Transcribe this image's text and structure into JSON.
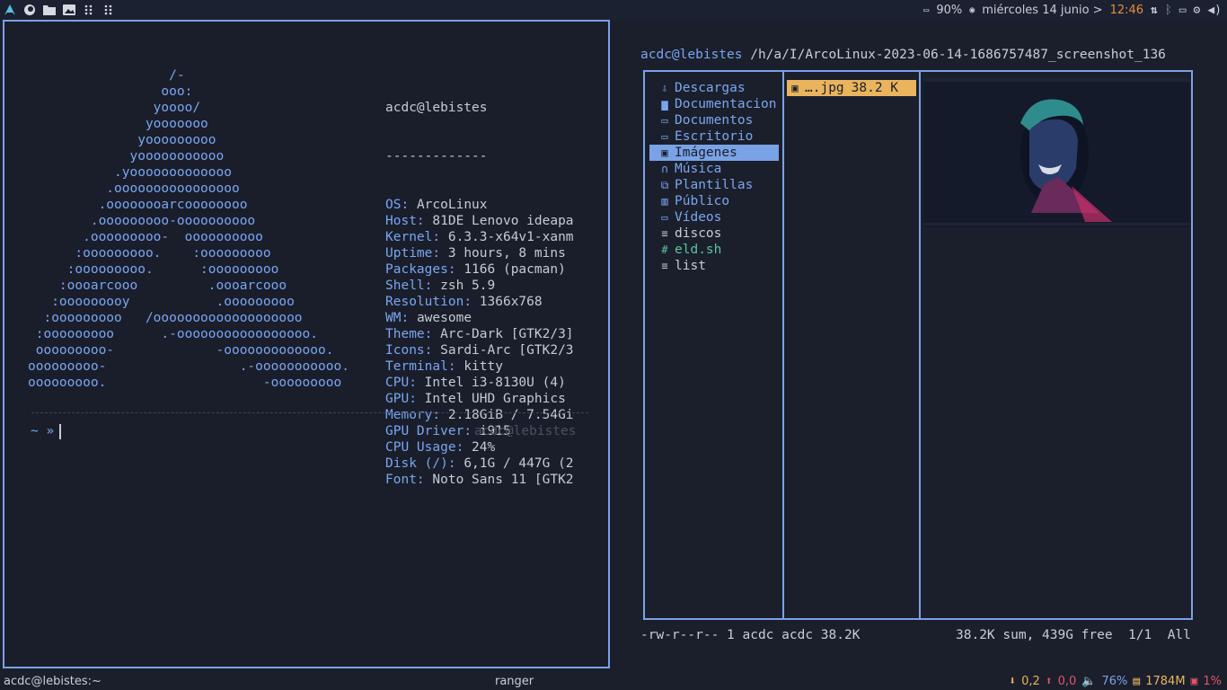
{
  "colors": {
    "accent": "#7aa2e6",
    "background": "#1b1f2c",
    "orange": "#e98a3f",
    "green": "#58c69a",
    "yellow": "#e9b45c",
    "red": "#e0566a"
  },
  "topbar": {
    "icons": [
      "arch-logo-icon",
      "firefox-icon",
      "folder-icon",
      "image-viewer-icon",
      "grid-icon",
      "grid-icon"
    ],
    "battery": "90%",
    "date": "miércoles 14 junio >",
    "time": "12:46"
  },
  "terminal": {
    "ascii_lines": [
      "                  /-",
      "                 ooo:",
      "                yoooo/",
      "               yooooooo",
      "              yooooooooo",
      "             yooooooooooo",
      "           .yooooooooooooo",
      "          .oooooooooooooooo",
      "         .oooooooarcoooooooo",
      "        .ooooooooo-oooooooooo",
      "       .ooooooooo-  oooooooooo",
      "      :ooooooooo.    :ooooooooo",
      "     :ooooooooo.      :ooooooooo",
      "    :oooarcooo         .oooarcooo",
      "   :ooooooooy           .ooooooooo",
      "  :ooooooooo   /ooooooooooooooooooo",
      " :ooooooooo      .-ooooooooooooooooo.",
      " ooooooooo-             -ooooooooooooo.",
      "ooooooooo-                 .-ooooooooooo.",
      "ooooooooo.                    -ooooooooo"
    ],
    "userhost": "acdc@lebistes",
    "underline": "-------------",
    "info": [
      {
        "key": "OS",
        "value": "ArcoLinux"
      },
      {
        "key": "Host",
        "value": "81DE Lenovo ideapa"
      },
      {
        "key": "Kernel",
        "value": "6.3.3-x64v1-xanm"
      },
      {
        "key": "Uptime",
        "value": "3 hours, 8 mins"
      },
      {
        "key": "Packages",
        "value": "1166 (pacman)"
      },
      {
        "key": "Shell",
        "value": "zsh 5.9"
      },
      {
        "key": "Resolution",
        "value": "1366x768"
      },
      {
        "key": "WM",
        "value": "awesome"
      },
      {
        "key": "Theme",
        "value": "Arc-Dark [GTK2/3]"
      },
      {
        "key": "Icons",
        "value": "Sardi-Arc [GTK2/3"
      },
      {
        "key": "Terminal",
        "value": "kitty"
      },
      {
        "key": "CPU",
        "value": "Intel i3-8130U (4)"
      },
      {
        "key": "GPU",
        "value": "Intel UHD Graphics"
      },
      {
        "key": "Memory",
        "value": "2.18GiB / 7.54Gi"
      },
      {
        "key": "GPU Driver",
        "value": "i915"
      },
      {
        "key": "CPU Usage",
        "value": "24%"
      },
      {
        "key": "Disk (/)",
        "value": "6,1G / 447G (2"
      },
      {
        "key": "Font",
        "value": "Noto Sans 11 [GTK2"
      }
    ],
    "prompt": "~ »",
    "right_prompt": "acdc@lebistes"
  },
  "ranger": {
    "user": "acdc@lebistes",
    "path": " /h/a/I/ArcoLinux-2023-06-14-1686757487_screenshot_136",
    "files": [
      {
        "icon": "download-icon",
        "glyph": "⇩",
        "name": "Descargas",
        "kind": "dir"
      },
      {
        "icon": "folder-icon",
        "glyph": "▆",
        "name": "Documentacion",
        "kind": "dir"
      },
      {
        "icon": "document-icon",
        "glyph": "▭",
        "name": "Documentos",
        "kind": "dir"
      },
      {
        "icon": "desktop-icon",
        "glyph": "▭",
        "name": "Escritorio",
        "kind": "dir"
      },
      {
        "icon": "image-icon",
        "glyph": "▣",
        "name": "Imágenes",
        "kind": "selected"
      },
      {
        "icon": "headphones-icon",
        "glyph": "∩",
        "name": "Música",
        "kind": "dir"
      },
      {
        "icon": "templates-icon",
        "glyph": "⧉",
        "name": "Plantillas",
        "kind": "dir"
      },
      {
        "icon": "building-icon",
        "glyph": "▥",
        "name": "Público",
        "kind": "dir"
      },
      {
        "icon": "video-icon",
        "glyph": "▭",
        "name": "Vídeos",
        "kind": "dir"
      },
      {
        "icon": "text-icon",
        "glyph": "≡",
        "name": "discos",
        "kind": "plain"
      },
      {
        "icon": "hash-icon",
        "glyph": "#",
        "name": "eld.sh",
        "kind": "exec"
      },
      {
        "icon": "text-icon",
        "glyph": "≡",
        "name": "list",
        "kind": "plain"
      }
    ],
    "selected_file": {
      "name": "….jpg",
      "size": "38.2 K"
    },
    "status_left": "-rw-r--r-- 1 acdc acdc 38.2K",
    "status_right": "38.2K sum, 439G free  1/1  All"
  },
  "bottombar": {
    "left": "acdc@lebistes:~",
    "center": "ranger",
    "down": "0,2",
    "up": "0,0",
    "volume": "76%",
    "memory": "1784M",
    "cpu": "1%"
  }
}
